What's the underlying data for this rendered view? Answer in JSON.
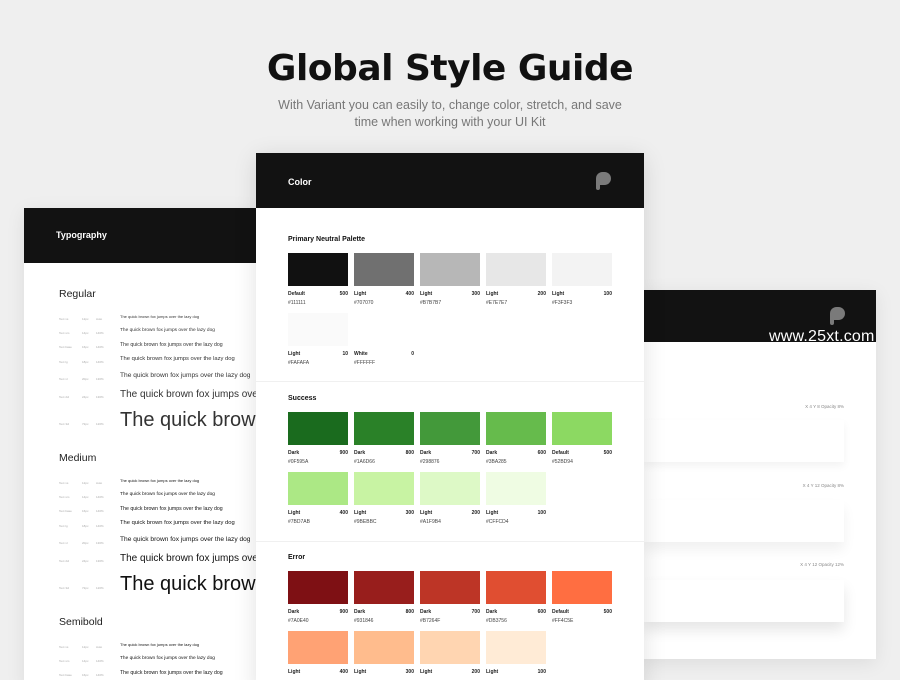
{
  "hero": {
    "title": "Global Style Guide",
    "subtitle": "With Variant you can easily to, change color, stretch, and save time when working with your UI Kit"
  },
  "typography": {
    "title": "Typography",
    "sections": [
      {
        "heading": "Regular",
        "rows": [
          {
            "name": "Text xs",
            "size": "12px",
            "lh": "Auto",
            "sample": "The quick brown fox jumps over the lazy dog"
          },
          {
            "name": "Text sm",
            "size": "14px",
            "lh": "140%",
            "sample": "The quick brown fox jumps over the lazy dog"
          },
          {
            "name": "Text base",
            "size": "16px",
            "lh": "140%",
            "sample": "The quick brown fox jumps over the lazy dog"
          },
          {
            "name": "Text lg",
            "size": "18px",
            "lh": "140%",
            "sample": "The quick brown fox jumps over the lazy dog"
          },
          {
            "name": "Text xl",
            "size": "20px",
            "lh": "130%",
            "sample": "The quick brown fox jumps over the lazy dog"
          },
          {
            "name": "Text 2xl",
            "size": "24px",
            "lh": "130%",
            "sample": "The quick brown fox jumps over the lazy dog"
          },
          {
            "name": "Text 3xl",
            "size": "72px",
            "lh": "120%",
            "sample": "The quick brown fox jumps over the lazy dog"
          }
        ]
      },
      {
        "heading": "Medium",
        "rows": [
          {
            "name": "Text xs",
            "size": "12px",
            "lh": "Auto",
            "sample": "The quick brown fox jumps over the lazy dog"
          },
          {
            "name": "Text sm",
            "size": "14px",
            "lh": "140%",
            "sample": "The quick brown fox jumps over the lazy dog"
          },
          {
            "name": "Text base",
            "size": "16px",
            "lh": "140%",
            "sample": "The quick brown fox jumps over the lazy dog"
          },
          {
            "name": "Text lg",
            "size": "18px",
            "lh": "140%",
            "sample": "The quick brown fox jumps over the lazy dog"
          },
          {
            "name": "Text xl",
            "size": "20px",
            "lh": "130%",
            "sample": "The quick brown fox jumps over the lazy dog"
          },
          {
            "name": "Text 2xl",
            "size": "24px",
            "lh": "130%",
            "sample": "The quick brown fox jumps over the lazy dog"
          },
          {
            "name": "Text 3xl",
            "size": "72px",
            "lh": "120%",
            "sample": "The quick brown fox jumps over the lazy dog"
          }
        ]
      },
      {
        "heading": "Semibold",
        "rows": [
          {
            "name": "Text xs",
            "size": "12px",
            "lh": "Auto",
            "sample": "The quick brown fox jumps over the lazy dog"
          },
          {
            "name": "Text sm",
            "size": "14px",
            "lh": "140%",
            "sample": "The quick brown fox jumps over the lazy dog"
          },
          {
            "name": "Text base",
            "size": "16px",
            "lh": "140%",
            "sample": "The quick brown fox jumps over the lazy dog"
          }
        ]
      }
    ]
  },
  "color": {
    "title": "Color",
    "logo_icon": "brand-logo-icon",
    "groups": [
      {
        "title": "Primary Neutral Palette",
        "swatches": [
          {
            "name": "Default",
            "weight": "500",
            "hex": "#111111"
          },
          {
            "name": "Light",
            "weight": "400",
            "hex": "#707070"
          },
          {
            "name": "Light",
            "weight": "300",
            "hex": "#B7B7B7"
          },
          {
            "name": "Light",
            "weight": "200",
            "hex": "#E7E7E7"
          },
          {
            "name": "Light",
            "weight": "100",
            "hex": "#F3F3F3"
          },
          {
            "name": "Light",
            "weight": "10",
            "hex": "#FAFAFA"
          },
          {
            "name": "White",
            "weight": "0",
            "hex": "#FFFFFF"
          }
        ]
      },
      {
        "title": "Success",
        "swatches": [
          {
            "name": "Dark",
            "weight": "900",
            "hex": "#0F595A",
            "display": "#1A6B1E"
          },
          {
            "name": "Dark",
            "weight": "800",
            "hex": "#1A6D66",
            "display": "#2A8128"
          },
          {
            "name": "Dark",
            "weight": "700",
            "hex": "#298876",
            "display": "#43993A"
          },
          {
            "name": "Dark",
            "weight": "600",
            "hex": "#3BA285",
            "display": "#66BB4C"
          },
          {
            "name": "Default",
            "weight": "500",
            "hex": "#52BD94",
            "display": "#8CD962"
          },
          {
            "name": "Light",
            "weight": "400",
            "hex": "#7BD7AB",
            "display": "#ACE885"
          },
          {
            "name": "Light",
            "weight": "300",
            "hex": "#9BEBBC",
            "display": "#C8F3A3"
          },
          {
            "name": "Light",
            "weight": "200",
            "hex": "#A1F9B4",
            "display": "#DDF9C6"
          },
          {
            "name": "Light",
            "weight": "100",
            "hex": "#CFFCD4",
            "display": "#EFFCE3"
          }
        ]
      },
      {
        "title": "Error",
        "swatches": [
          {
            "name": "Dark",
            "weight": "900",
            "hex": "#7A0E40",
            "display": "#7E1014"
          },
          {
            "name": "Dark",
            "weight": "800",
            "hex": "#931846",
            "display": "#981E1C"
          },
          {
            "name": "Dark",
            "weight": "700",
            "hex": "#B7264F",
            "display": "#BD3526"
          },
          {
            "name": "Dark",
            "weight": "600",
            "hex": "#DB3756",
            "display": "#E04E31"
          },
          {
            "name": "Default",
            "weight": "500",
            "hex": "#FF4C5E",
            "display": "#FF6E41"
          },
          {
            "name": "Light",
            "weight": "400",
            "hex": "",
            "display": "#FFA274"
          },
          {
            "name": "Light",
            "weight": "300",
            "hex": "",
            "display": "#FFBC8D"
          },
          {
            "name": "Light",
            "weight": "200",
            "hex": "",
            "display": "#FFD5B1"
          },
          {
            "name": "Light",
            "weight": "100",
            "hex": "",
            "display": "#FFEBD6"
          }
        ]
      }
    ]
  },
  "effects": {
    "logo_icon": "brand-logo-icon",
    "items": [
      {
        "label": "X 4 Y 8 Opacity 8%"
      },
      {
        "label": "X 4 Y 12 Opacity 8%"
      },
      {
        "label": "X 4 Y 12 Opacity 12%"
      }
    ]
  },
  "watermark": "www.25xt.com"
}
